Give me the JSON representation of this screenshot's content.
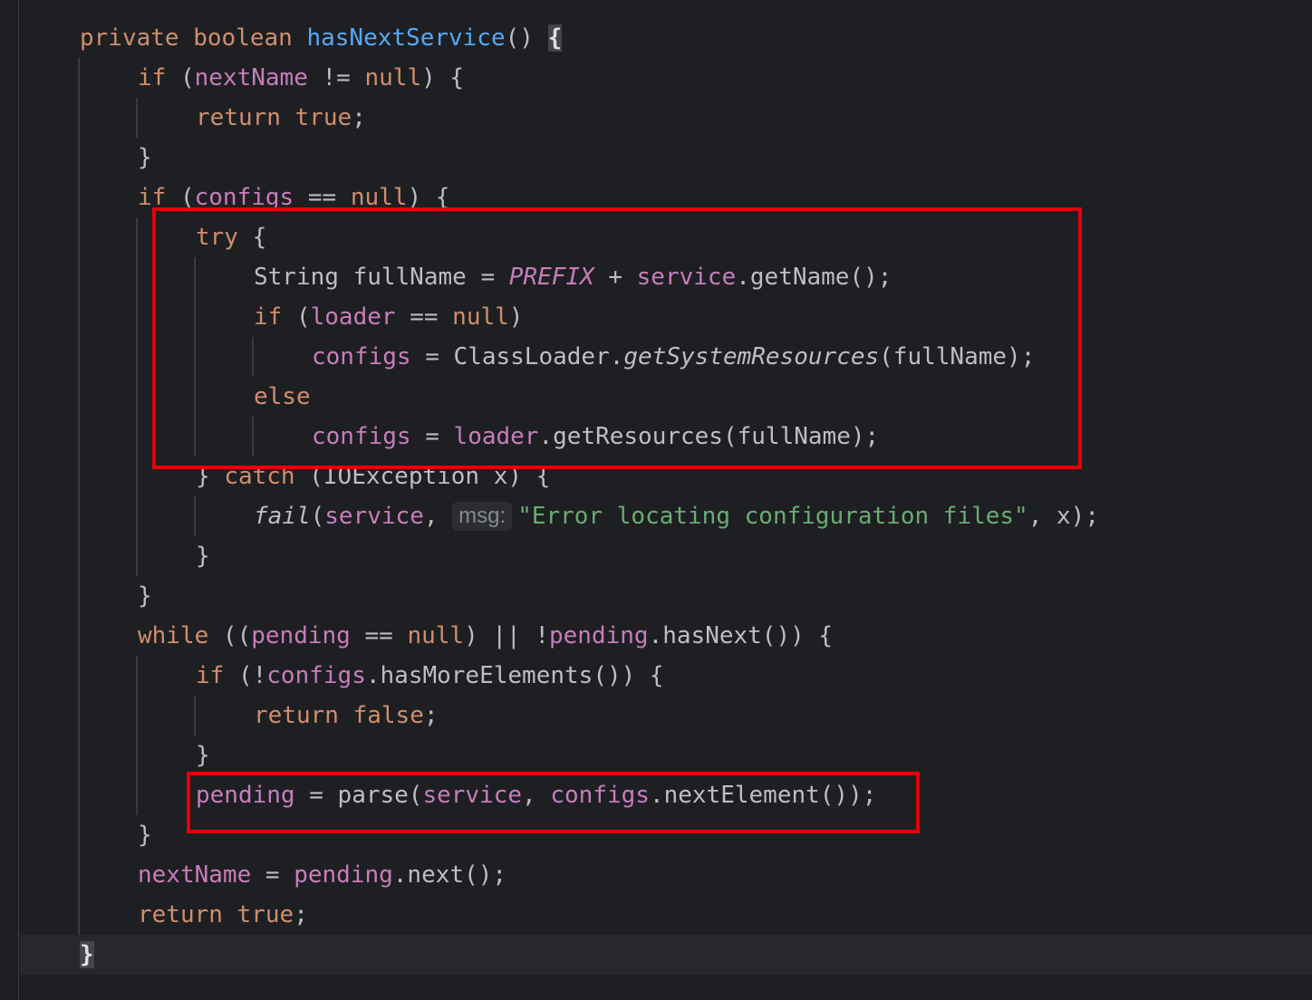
{
  "code": {
    "l1": [
      "private",
      "boolean",
      "hasNextService",
      "() ",
      "{"
    ],
    "l2": [
      "if",
      " (",
      "nextName",
      " != ",
      "null",
      ") {"
    ],
    "l3": [
      "return",
      "true",
      ";"
    ],
    "l4": [
      "}"
    ],
    "l5": [
      "if",
      " (",
      "configs",
      " == ",
      "null",
      ") {"
    ],
    "l6": [
      "try",
      " {"
    ],
    "l7": [
      "String fullName = ",
      "PREFIX",
      " + ",
      "service",
      ".getName();"
    ],
    "l8": [
      "if",
      " (",
      "loader",
      " == ",
      "null",
      ")"
    ],
    "l9": [
      "configs",
      " = ClassLoader.",
      "getSystemResources",
      "(fullName);"
    ],
    "l10": [
      "else"
    ],
    "l11": [
      "configs",
      " = ",
      "loader",
      ".getResources(fullName);"
    ],
    "l12": [
      "} ",
      "catch",
      " (IOException x) {"
    ],
    "l13": [
      "fail",
      "(",
      "service",
      ", ",
      "msg:",
      "\"Error locating configuration files\"",
      ", x);"
    ],
    "l14": [
      "}"
    ],
    "l15": [
      "}"
    ],
    "l16": [
      "while",
      " ((",
      "pending",
      " == ",
      "null",
      ") || !",
      "pending",
      ".hasNext()) {"
    ],
    "l17": [
      "if",
      " (!",
      "configs",
      ".hasMoreElements()) {"
    ],
    "l18": [
      "return",
      "false",
      ";"
    ],
    "l19": [
      "}"
    ],
    "l20": [
      "pending",
      " = parse(",
      "service",
      ", ",
      "configs",
      ".nextElement());"
    ],
    "l21": [
      "}"
    ],
    "l22": [
      "nextName",
      " = ",
      "pending",
      ".next();"
    ],
    "l23": [
      "return",
      "true",
      ";"
    ],
    "l24": [
      "}"
    ]
  },
  "colors": {
    "background": "#1e1f22",
    "keyword": "#cf8e6d",
    "method_declaration": "#56a8f5",
    "field": "#c77dbb",
    "string": "#6aab73",
    "default_text": "#bcbec4",
    "highlight_box": "#e5000a"
  }
}
